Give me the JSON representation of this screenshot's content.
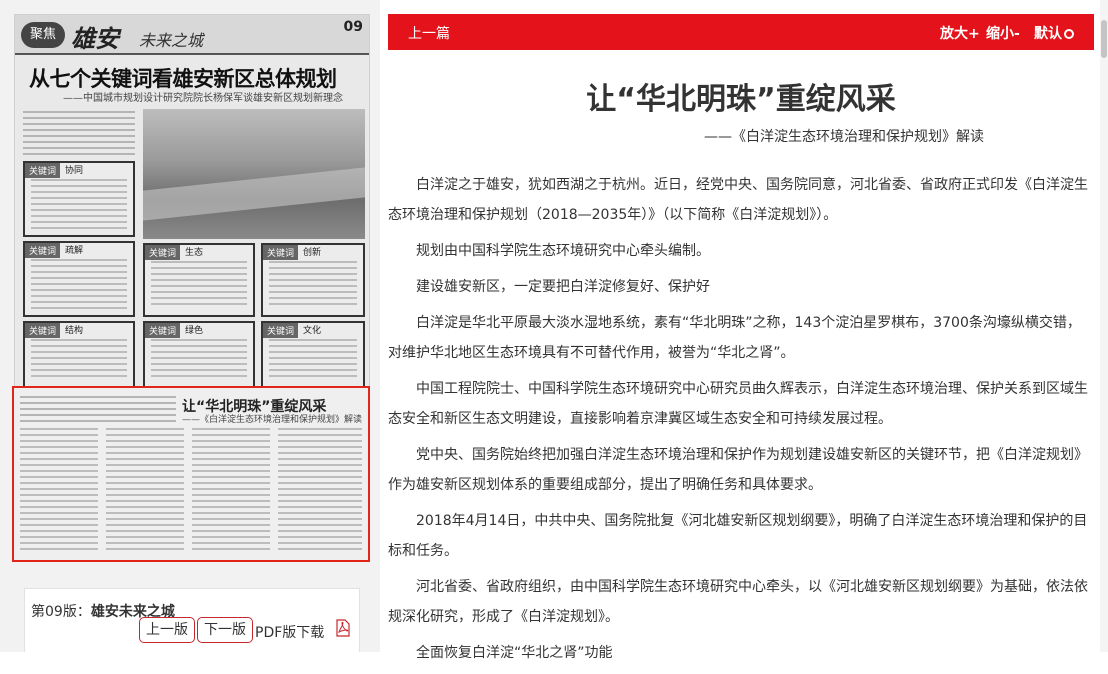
{
  "newspaper": {
    "tag": "聚焦",
    "masthead": "雄安",
    "masthead_sub": "未来之城",
    "page_no": "09",
    "headline": "从七个关键词看雄安新区总体规划",
    "subheadline": "——中国城市规划设计研究院院长杨保军谈雄安新区规划新理念",
    "boxes": [
      "协同",
      "疏解",
      "生态",
      "创新",
      "结构",
      "绿色",
      "文化"
    ],
    "highlight_title": "让“华北明珠”重绽风采",
    "highlight_sub": "——《白洋淀生态环境治理和保护规划》解读"
  },
  "edition": {
    "prefix": "第09版：",
    "name": "雄安未来之城",
    "prev_label": "上一版",
    "next_label": "下一版",
    "pdf_label": "PDF版下载"
  },
  "toolbar": {
    "prev_article": "上一篇",
    "zoom_in": "放大+",
    "zoom_out": "缩小-",
    "default": "默认"
  },
  "article": {
    "title": "让“华北明珠”重绽风采",
    "subtitle": "——《白洋淀生态环境治理和保护规划》解读",
    "paragraphs": [
      "白洋淀之于雄安，犹如西湖之于杭州。近日，经党中央、国务院同意，河北省委、省政府正式印发《白洋淀生态环境治理和保护规划（2018—2035年）》（以下简称《白洋淀规划》）。",
      "规划由中国科学院生态环境研究中心牵头编制。",
      "建设雄安新区，一定要把白洋淀修复好、保护好",
      "白洋淀是华北平原最大淡水湿地系统，素有“华北明珠”之称，143个淀泊星罗棋布，3700条沟壕纵横交错，对维护华北地区生态环境具有不可替代作用，被誉为“华北之肾”。",
      "中国工程院院士、中国科学院生态环境研究中心研究员曲久辉表示，白洋淀生态环境治理、保护关系到区域生态安全和新区生态文明建设，直接影响着京津冀区域生态安全和可持续发展过程。",
      "党中央、国务院始终把加强白洋淀生态环境治理和保护作为规划建设雄安新区的关键环节，把《白洋淀规划》作为雄安新区规划体系的重要组成部分，提出了明确任务和具体要求。",
      "2018年4月14日，中共中央、国务院批复《河北雄安新区规划纲要》，明确了白洋淀生态环境治理和保护的目标和任务。",
      "河北省委、省政府组织，由中国科学院生态环境研究中心牵头，以《河北雄安新区规划纲要》为基础，依法依规深化研究，形成了《白洋淀规划》。",
      "全面恢复白洋淀“华北之肾”功能"
    ]
  }
}
